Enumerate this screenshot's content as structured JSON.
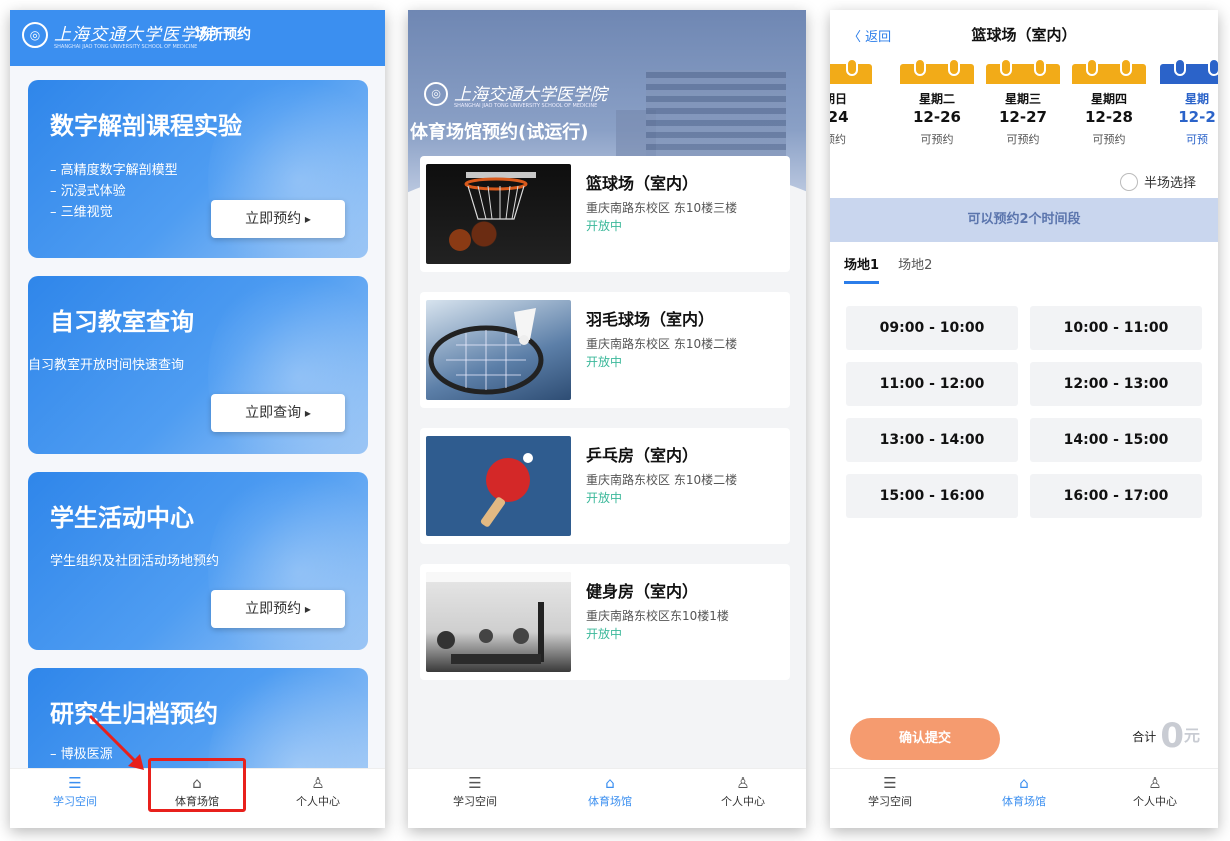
{
  "phone1": {
    "logo_text": "上海交通大学医学院",
    "logo_sub": "SHANGHAI JIAO TONG UNIVERSITY SCHOOL OF MEDICINE",
    "header_title": "场所预约",
    "cards": [
      {
        "title": "数字解剖课程实验",
        "bullets": [
          "高精度数字解剖模型",
          "沉浸式体验",
          "三维视觉"
        ],
        "button": "立即预约"
      },
      {
        "title": "自习教室查询",
        "subtitle": "自习教室开放时间快速查询",
        "button": "立即查询"
      },
      {
        "title": "学生活动中心",
        "subtitle": "学生组织及社团活动场地预约",
        "button": "立即预约"
      },
      {
        "title": "研究生归档预约",
        "bullets": [
          "博极医源"
        ]
      }
    ]
  },
  "tabbar": {
    "study": "学习空间",
    "sports": "体育场馆",
    "profile": "个人中心"
  },
  "phone2": {
    "logo_text": "上海交通大学医学院",
    "logo_sub": "SHANGHAI JIAO TONG UNIVERSITY SCHOOL OF MEDICINE",
    "hero_title": "体育场馆预约(试运行)",
    "venues": [
      {
        "name": "篮球场（室内）",
        "address": "重庆南路东校区 东10楼三楼",
        "status": "开放中"
      },
      {
        "name": "羽毛球场（室内）",
        "address": "重庆南路东校区 东10楼二楼",
        "status": "开放中"
      },
      {
        "name": "乒乓房（室内）",
        "address": "重庆南路东校区 东10楼二楼",
        "status": "开放中"
      },
      {
        "name": "健身房（室内）",
        "address": "重庆南路东校区东10楼1楼",
        "status": "开放中"
      }
    ]
  },
  "phone3": {
    "back": "〈 返回",
    "title": "篮球场（室内）",
    "dates": [
      {
        "weekday": "期日",
        "date": "-24",
        "status": "预约"
      },
      {
        "weekday": "星期二",
        "date": "12-26",
        "status": "可预约"
      },
      {
        "weekday": "星期三",
        "date": "12-27",
        "status": "可预约"
      },
      {
        "weekday": "星期四",
        "date": "12-28",
        "status": "可预约"
      },
      {
        "weekday": "星期",
        "date": "12-2",
        "status": "可预"
      }
    ],
    "half_court": "半场选择",
    "band": "可以预约2个时间段",
    "fields": [
      "场地1",
      "场地2"
    ],
    "slots": [
      "09:00 - 10:00",
      "10:00 - 11:00",
      "11:00 - 12:00",
      "12:00 - 13:00",
      "13:00 - 14:00",
      "14:00 - 15:00",
      "15:00 - 16:00",
      "16:00 - 17:00"
    ],
    "submit": "确认提交",
    "total_label": "合计",
    "total_amount": "0",
    "total_unit": "元"
  }
}
